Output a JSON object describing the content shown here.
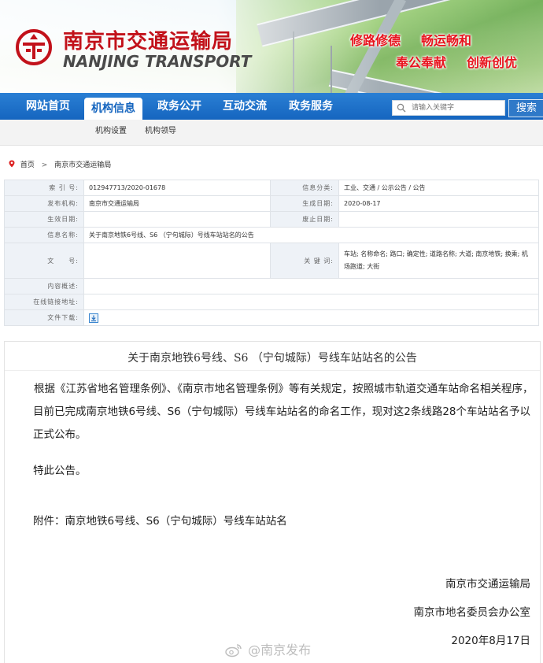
{
  "header": {
    "brand_cn": "南京市交通运输局",
    "brand_en": "NANJING TRANSPORT",
    "slogans": [
      "修路修德",
      "畅运畅和",
      "奉公奉献",
      "创新创优"
    ],
    "brand_color": "#c2111a",
    "slogan_color": "#e8141e"
  },
  "nav": {
    "items": [
      "网站首页",
      "机构信息",
      "政务公开",
      "互动交流",
      "政务服务"
    ],
    "active_index": 1,
    "color": "#1565bf"
  },
  "search": {
    "placeholder": "请输入关键字",
    "button_label": "搜索"
  },
  "subnav": {
    "items": [
      "机构设置",
      "机构领导"
    ]
  },
  "breadcrumb": {
    "items": [
      "首页",
      "南京市交通运输局"
    ]
  },
  "info_table": {
    "index_label": "索 引 号:",
    "index_value": "012947713/2020-01678",
    "category_label": "信息分类:",
    "category_value": "工业、交通 / 公示公告 / 公告",
    "org_label": "发布机构:",
    "org_value": "南京市交通运输局",
    "date_label": "生成日期:",
    "date_value": "2020-08-17",
    "effective_label": "生效日期:",
    "effective_value": "",
    "expiry_label": "废止日期:",
    "expiry_value": "",
    "name_label": "信息名称:",
    "name_value": "关于南京地铁6号线、S6 （宁句城际）号线车站站名的公告",
    "docno_label": "文　　号:",
    "docno_value": "",
    "keywords_label": "关 键 词:",
    "keywords_value": "车站; 名称命名; 路口; 确定性; 道路名称; 大道; 南京地铁; 换乘; 机场跑道; 大街",
    "summary_label": "内容概述:",
    "summary_value": "",
    "link_label": "在线链接地址:",
    "link_value": "",
    "download_label": "文件下载:"
  },
  "article": {
    "title": "关于南京地铁6号线、S6 （宁句城际）号线车站站名的公告",
    "para1": "根据《江苏省地名管理条例》、《南京市地名管理条例》等有关规定，按照城市轨道交通车站命名相关程序，目前已完成南京地铁6号线、S6（宁句城际）号线车站站名的命名工作，现对这2条线路28个车站站名予以正式公布。",
    "para2": "特此公告。",
    "attachment": "附件：南京地铁6号线、S6（宁句城际）号线车站站名",
    "signer1": "南京市交通运输局",
    "signer2": "南京市地名委员会办公室",
    "date": "2020年8月17日"
  },
  "watermark": {
    "text": "@南京发布",
    "icon": "weibo-icon"
  }
}
